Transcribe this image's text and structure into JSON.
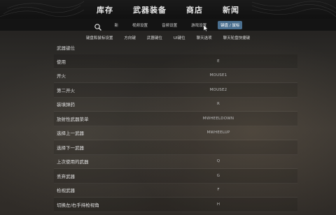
{
  "topnav": {
    "tabs": [
      "库存",
      "武器装备",
      "商店",
      "新闻"
    ]
  },
  "subnav": {
    "items": [
      "新",
      "视频设置",
      "音频设置",
      "游戏设置",
      "键盘 / 鼠标"
    ],
    "active_index": 4
  },
  "categories": {
    "items": [
      "键盘和鼠标设置",
      "方向键",
      "武器键位",
      "UI键位",
      "聊天选项",
      "聊天轮盘快捷键"
    ]
  },
  "bindings": {
    "section_title": "武器键位",
    "rows": [
      {
        "label": "使用",
        "key": "E"
      },
      {
        "label": "开火",
        "key": "MOUSE1"
      },
      {
        "label": "第二开火",
        "key": "MOUSE2"
      },
      {
        "label": "装填弹药",
        "key": "R"
      },
      {
        "label": "放射性武器菜单",
        "key": "MWHEELDOWN"
      },
      {
        "label": "选择上一武器",
        "key": "MWHEELUP"
      },
      {
        "label": "选择下一武器",
        "key": ""
      },
      {
        "label": "上次使用的武器",
        "key": "Q"
      },
      {
        "label": "丢弃武器",
        "key": "G"
      },
      {
        "label": "检视武器",
        "key": "F"
      },
      {
        "label": "切换左/右手持枪视角",
        "key": "H"
      }
    ]
  },
  "colors": {
    "accent": "#4a6f8f",
    "background": "#2e2c29"
  }
}
